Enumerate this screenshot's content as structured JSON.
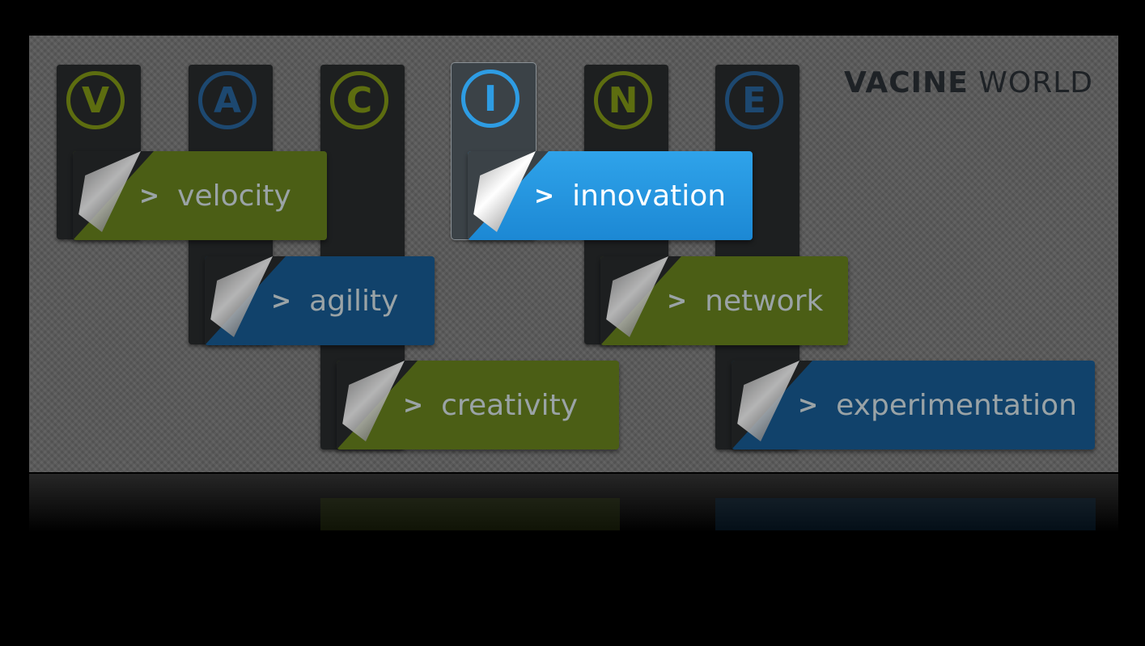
{
  "brand": {
    "bold": "VACINE",
    "light": "WORLD"
  },
  "letters": [
    "V",
    "A",
    "C",
    "I",
    "N",
    "E"
  ],
  "tabs": {
    "velocity": {
      "chevron": ">",
      "label": "velocity"
    },
    "agility": {
      "chevron": ">",
      "label": "agility"
    },
    "creativity": {
      "chevron": ">",
      "label": "creativity"
    },
    "innovation": {
      "chevron": ">",
      "label": "innovation"
    },
    "network": {
      "chevron": ">",
      "label": "network"
    },
    "experimentation": {
      "chevron": ">",
      "label": "experimentation"
    }
  },
  "active": "innovation",
  "colors": {
    "green": "#4b5e15",
    "blue": "#11426b",
    "active": "#2fa3ea",
    "panel": "#585858"
  }
}
